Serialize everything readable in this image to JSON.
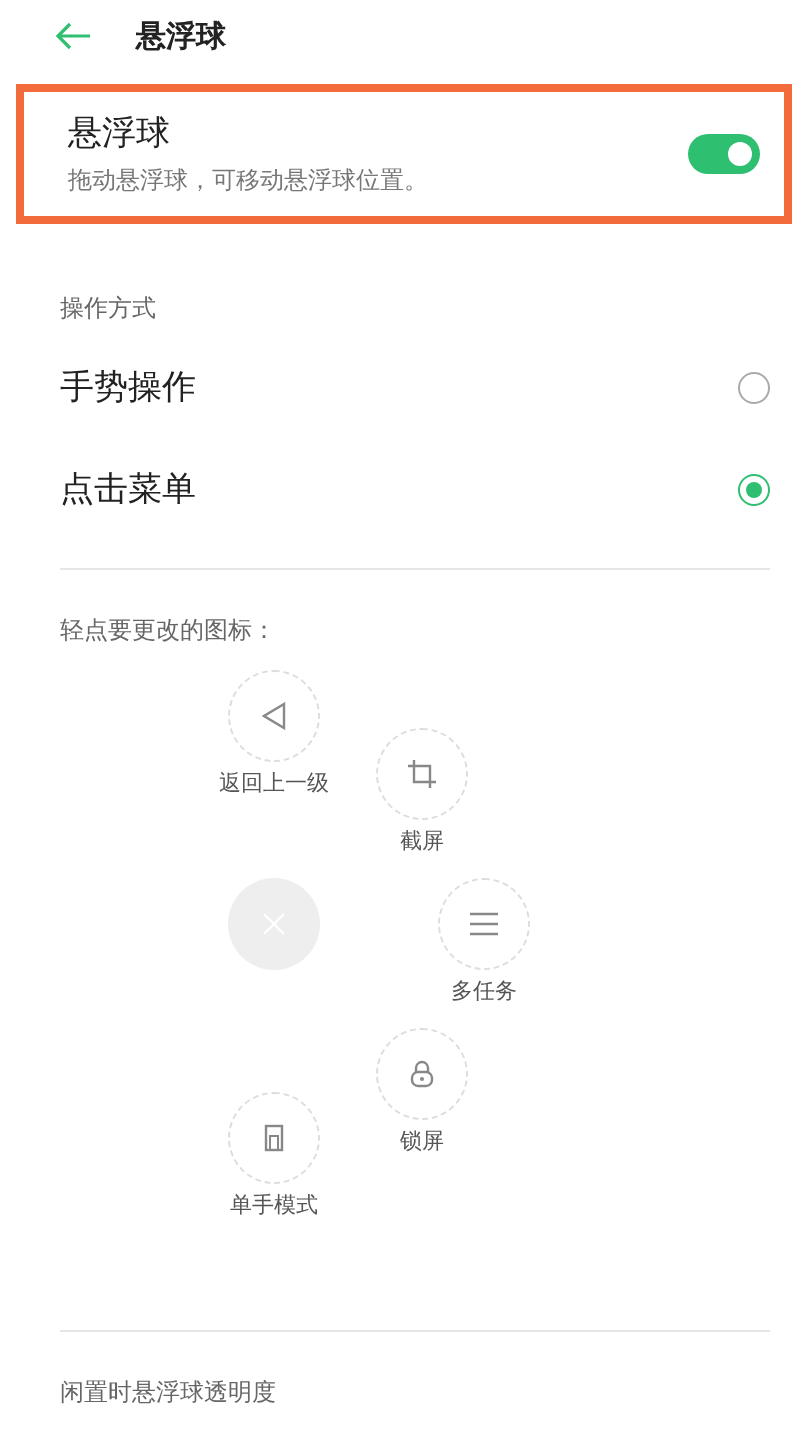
{
  "header": {
    "title": "悬浮球"
  },
  "floating_ball": {
    "title": "悬浮球",
    "description": "拖动悬浮球，可移动悬浮球位置。",
    "on": true
  },
  "operation": {
    "title": "操作方式",
    "options": [
      {
        "label": "手势操作",
        "selected": false
      },
      {
        "label": "点击菜单",
        "selected": true
      }
    ]
  },
  "icons": {
    "prompt": "轻点要更改的图标：",
    "items": [
      {
        "kind": "back",
        "label": "返回上一级"
      },
      {
        "kind": "crop",
        "label": "截屏"
      },
      {
        "kind": "close"
      },
      {
        "kind": "multitask",
        "label": "多任务"
      },
      {
        "kind": "lock",
        "label": "锁屏"
      },
      {
        "kind": "onehand",
        "label": "单手模式"
      }
    ]
  },
  "idle_opacity": {
    "title": "闲置时悬浮球透明度"
  }
}
